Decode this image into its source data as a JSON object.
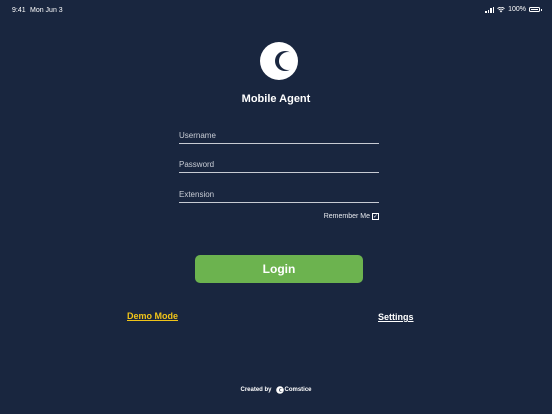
{
  "status_bar": {
    "time": "9:41",
    "date": "Mon Jun 3",
    "battery": "100%"
  },
  "app": {
    "title": "Mobile Agent",
    "logo_icon": "crescent-logo-icon"
  },
  "form": {
    "username_placeholder": "Username",
    "password_placeholder": "Password",
    "extension_placeholder": "Extension",
    "username_value": "",
    "password_value": "",
    "extension_value": "",
    "remember_label": "Remember Me",
    "remember_checked": true
  },
  "actions": {
    "login_label": "Login",
    "demo_label": "Demo Mode",
    "settings_label": "Settings"
  },
  "footer": {
    "created_label": "Created by",
    "brand": "Comstice"
  },
  "colors": {
    "background": "#19263f",
    "login_button": "#6cb34f",
    "demo_link": "#f0c419"
  }
}
